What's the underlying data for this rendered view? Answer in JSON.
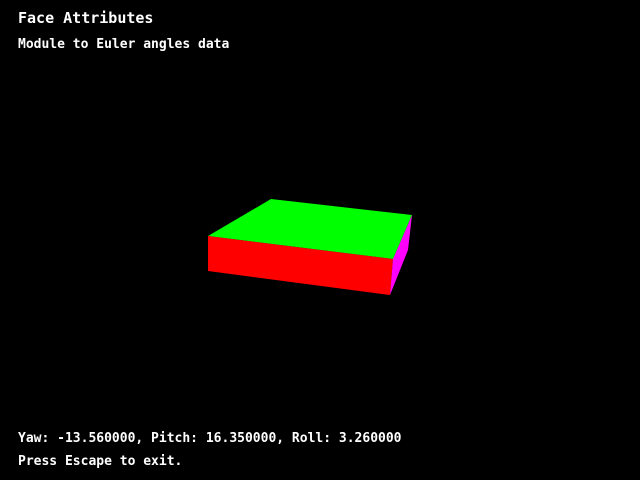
{
  "window": {
    "title": "Face Attributes",
    "subtitle": "Module to Euler angles data"
  },
  "pose": {
    "readout": "Yaw: -13.560000, Pitch: 16.350000, Roll: 3.260000",
    "yaw": -13.56,
    "pitch": 16.35,
    "roll": 3.26
  },
  "footer": {
    "hint": "Press Escape to exit."
  },
  "colors": {
    "background": "#000000",
    "text": "#ffffff",
    "box_top": "#00ff00",
    "box_front": "#ff0000",
    "box_side": "#ff00ff"
  }
}
